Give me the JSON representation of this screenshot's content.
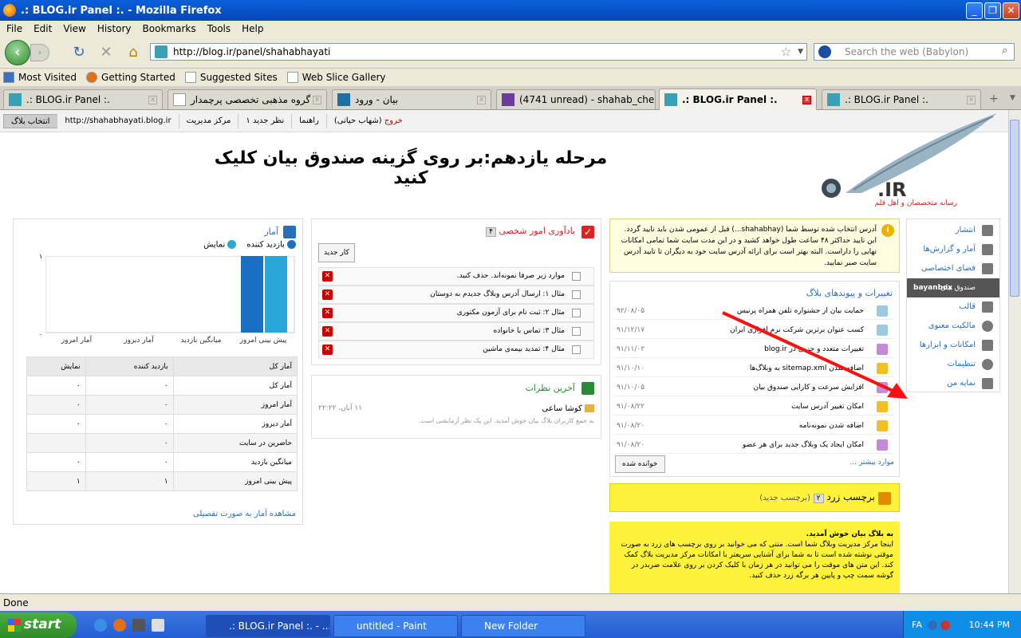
{
  "window": {
    "title": ".: BLOG.ir Panel :. - Mozilla Firefox"
  },
  "menu": [
    "File",
    "Edit",
    "View",
    "History",
    "Bookmarks",
    "Tools",
    "Help"
  ],
  "nav": {
    "url": "http://blog.ir/panel/shahabhayati",
    "search_placeholder": "Search the web (Babylon)"
  },
  "bookmarks": [
    "Most Visited",
    "Getting Started",
    "Suggested Sites",
    "Web Slice Gallery"
  ],
  "tabs": [
    {
      "label": ".: BLOG.ir Panel :."
    },
    {
      "label": "گروه مذهبی تخصصی پرچمدار"
    },
    {
      "label": "بیان - ورود"
    },
    {
      "label": "(4741 unread) - shahab_cher..."
    },
    {
      "label": ".: BLOG.ir Panel :."
    },
    {
      "label": ".: BLOG.ir Panel :."
    }
  ],
  "panelbar": {
    "choose": "انتخاب بلاگ",
    "blog_url": "http://shahabhayati.blog.ir",
    "manage": "مرکز مدیریت",
    "new_comment": "۱ نظر جدید",
    "help": "راهنما",
    "logout": "خروج",
    "user": "(شهاب حیاتی)"
  },
  "heading": "مرحله یازدهم:بر روی گزینه صندوق بیان کلیک کنید",
  "logo": {
    "brand": ".IR",
    "tagline": "رسانه متخصصان و اهل قلم"
  },
  "sidebar": [
    {
      "label": "انتشار",
      "icon": "publish-icon"
    },
    {
      "label": "آمار و گزارش‌ها",
      "icon": "chart-icon"
    },
    {
      "label": "فضای اختصاصی",
      "icon": "gear-icon"
    },
    {
      "label": "صندوق بیان",
      "sub": "bayanbox",
      "icon": "box-icon"
    },
    {
      "label": "قالب",
      "icon": "puzzle-icon"
    },
    {
      "label": "مالکیت معنوی",
      "icon": "copyright-icon"
    },
    {
      "label": "امکانات و ابزارها",
      "icon": "wrench-icon"
    },
    {
      "label": "تنظیمات",
      "icon": "settings-icon"
    },
    {
      "label": "نمایه من",
      "icon": "profile-icon"
    }
  ],
  "warning": "آدرس انتخاب شده توسط شما (shahabhay...) قبل از عمومی شدن باید تایید گردد. این تایید حداکثر ۴۸ ساعت طول خواهد کشید و در این مدت سایت شما تمامی امکانات نهایی را داراست. البته بهتر است برای ارائه آدرس سایت خود به دیگران تا تایید آدرس سایت صبر نمایید.",
  "updates": {
    "title": "تغییرات و پیوندهای بلاگ",
    "items": [
      {
        "text": "حمایت بیان از جشنواره تلفن همراه پرنیس",
        "date": "۹۲/۰۸/۰۵"
      },
      {
        "text": "کسب عنوان برترین شرکت نرم افزاری ایران",
        "date": "۹۱/۱۲/۱۷"
      },
      {
        "text": "تغییرات متعدد و جزیی در blog.ir",
        "date": "۹۱/۱۱/۰۲"
      },
      {
        "text": "اضافه شدن sitemap.xml به وبلاگ‌ها",
        "date": "۹۱/۱۰/۱۰"
      },
      {
        "text": "افزایش سرعت و کارایی صندوق بیان",
        "date": "۹۱/۱۰/۰۵"
      },
      {
        "text": "امکان تغییر آدرس سایت",
        "date": "۹۱/۰۸/۲۲"
      },
      {
        "text": "اضافه شدن نمونه‌نامه",
        "date": "۹۱/۰۸/۲۰"
      },
      {
        "text": "امکان ایجاد یک وبلاگ جدید برای هر عضو",
        "date": "۹۱/۰۸/۲۰"
      }
    ],
    "more": "موارد بیشتر ...",
    "read_button": "خوانده شده"
  },
  "yellow_tag": {
    "title": "برچسب زرد",
    "count": "۲",
    "sub": "(برچسب جدید)"
  },
  "welcome": {
    "title": "به بلاگ بیان خوش آمدید.",
    "body": "اینجا مرکز مدیریت وبلاگ شما است. متنی که می خوانید بر روی برچسب های زرد به صورت موقتی نوشته شده است تا به شما برای آشنایی سریعتر با امکانات مرکز مدیریت بلاگ کمک کند. این متن های موقت را می توانید در هر زمان با کلیک کردن بر روی علامت ضربدر در گوشه سمت چپ و پایین هر برگه زرد حذف کنید."
  },
  "todo": {
    "title": "یادآوری امور شخصی",
    "count": "۴",
    "new_button": "کار جدید",
    "items": [
      "موارد زیر صرفا نمونه‌اند. حذف کنید.",
      "مثال ۱: ارسال آدرس وبلاگ جدیدم به دوستان",
      "مثال ۲: ثبت نام برای آزمون مکتوری",
      "مثال ۳: تماس با خانواده",
      "مثال ۴: تمدید بیمه‌ی ماشین"
    ]
  },
  "comments": {
    "title": "آخرین نظرات",
    "author": "کوشا ساعی",
    "date": "۱۱ آبان، ۲۲:۲۲",
    "text": "به جمع کاربران بلاگ بیان خوش آمدید. این یک نظر آزمایشی است."
  },
  "stats": {
    "title": "آمار",
    "legend_visitors": "بازدید کننده",
    "legend_views": "نمایش",
    "y_max": "۱",
    "y_min": "۰",
    "table_headers": [
      "آمار کل",
      "بازدید کننده",
      "نمایش"
    ],
    "rows": [
      [
        "آمار کل",
        "۰",
        "۰"
      ],
      [
        "آمار امروز",
        "۰",
        "۰"
      ],
      [
        "آمار دیروز",
        "۰",
        "۰"
      ],
      [
        "حاضرین در سایت",
        "۰",
        ""
      ],
      [
        "میانگین بازدید",
        "۰",
        "۰"
      ],
      [
        "پیش بینی امروز",
        "۱",
        "۱"
      ]
    ],
    "detail_link": "مشاهده آمار به صورت تفصیلی"
  },
  "chart_data": {
    "type": "bar",
    "categories": [
      "پیش بینی امروز",
      "میانگین بازدید",
      "آمار دیروز",
      "آمار امروز"
    ],
    "series": [
      {
        "name": "بازدید کننده",
        "values": [
          1,
          0,
          0,
          0
        ]
      },
      {
        "name": "نمایش",
        "values": [
          1,
          0,
          0,
          0
        ]
      }
    ],
    "ylim": [
      0,
      1
    ],
    "colors": {
      "visitors": "#1a6fc4",
      "views": "#2aa6d8"
    }
  },
  "status": "Done",
  "taskbar": {
    "start": "start",
    "tasks": [
      ".: BLOG.ir Panel :. - ...",
      "untitled - Paint",
      "New Folder"
    ],
    "lang": "FA",
    "clock": "10:44 PM"
  }
}
